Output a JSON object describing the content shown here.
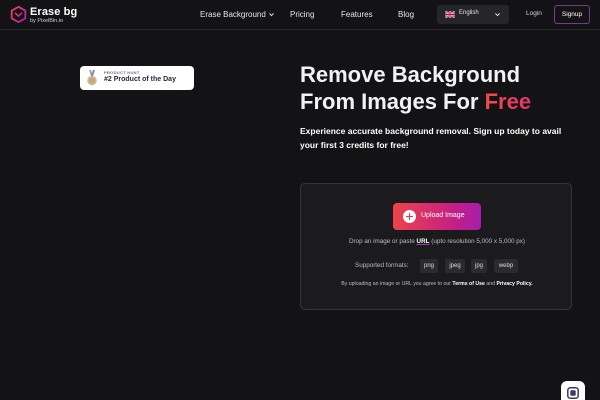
{
  "brand": {
    "name": "Erase bg",
    "byline": "by PixelBin.io",
    "colors": {
      "accent_start": "#f0424b",
      "accent_end": "#a71dad",
      "background": "#131315"
    }
  },
  "nav": {
    "items": [
      {
        "label": "Erase Background",
        "has_dropdown": true
      },
      {
        "label": "Pricing"
      },
      {
        "label": "Features"
      },
      {
        "label": "Blog"
      }
    ],
    "language": {
      "flag_icon": "uk-flag-icon",
      "selected": "English"
    },
    "login_label": "Login",
    "signup_label": "Signup"
  },
  "badge": {
    "kicker": "PRODUCT HUNT",
    "title": "#2 Product of the Day",
    "icon": "medal-icon"
  },
  "hero": {
    "title_line1": "Remove Background",
    "title_line2_prefix": "From Images For ",
    "title_accent": "Free",
    "subtitle": "Experience accurate background removal. Sign up today to avail your first 3 credits for free!"
  },
  "upload": {
    "button_label": "Upload Image",
    "drop_prefix": "Drop an image or paste ",
    "drop_link": "URL",
    "drop_suffix": " (upto resolution 5,000 x 5,000 px)",
    "formats_label": "Supported formats:",
    "formats": [
      "png",
      "jpeg",
      "jpg",
      "webp"
    ],
    "consent_prefix": "By uploading an image or URL you agree to our ",
    "terms_label": "Terms of Use",
    "consent_mid": " and ",
    "privacy_label": "Privacy Policy."
  },
  "chat": {
    "icon": "chat-icon"
  }
}
